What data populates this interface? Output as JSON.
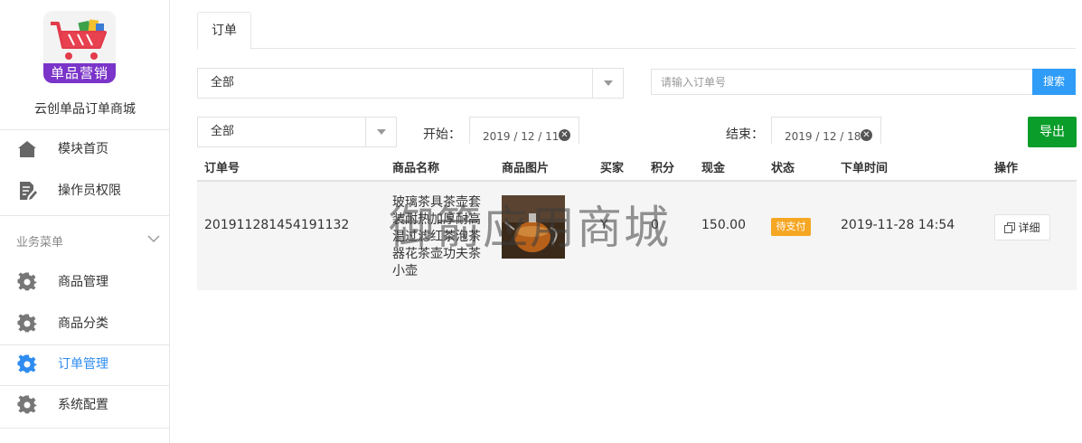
{
  "sidebar": {
    "logo_text": "单品营销",
    "brand_name": "云创单品订单商城",
    "top_items": [
      {
        "label": "模块首页",
        "icon": "home-icon"
      },
      {
        "label": "操作员权限",
        "icon": "document-edit-icon"
      }
    ],
    "section_title": "业务菜单",
    "items": [
      {
        "label": "商品管理",
        "icon": "gear-icon"
      },
      {
        "label": "商品分类",
        "icon": "gear-icon"
      },
      {
        "label": "订单管理",
        "icon": "gear-icon",
        "active": true
      },
      {
        "label": "系统配置",
        "icon": "gear-icon"
      }
    ]
  },
  "tabs": [
    {
      "label": "订单",
      "active": true
    }
  ],
  "filters": {
    "status_select": "全部",
    "type_select": "全部",
    "search_placeholder": "请输入订单号",
    "search_label": "搜索",
    "start_label": "开始：",
    "start_date": "2019 / 12 / 11",
    "end_label": "结束：",
    "end_date": "2019 / 12 / 18",
    "export_label": "导出",
    "clear_glyph": "✕"
  },
  "table": {
    "columns": [
      "订单号",
      "商品名称",
      "商品图片",
      "买家",
      "积分",
      "现金",
      "状态",
      "下单时间",
      "操作"
    ],
    "rows": [
      {
        "order_no": "201911281454191132",
        "product_name": "玻璃茶具茶壶套装耐热加厚耐高温过滤红茶泡茶器花茶壶功夫茶小壶",
        "buyer": "Y",
        "points": "0",
        "cash": "150.00",
        "status": "待支付",
        "order_time": "2019-11-28 14:54",
        "action_label": "详细"
      }
    ]
  },
  "watermark": "御箭应用商城",
  "colors": {
    "accent": "#2f8cf0",
    "search_button": "#2f9cf7",
    "export_button": "#0b9d2a",
    "status_pending": "#f5a623",
    "logo_banner": "#7b34c9"
  }
}
